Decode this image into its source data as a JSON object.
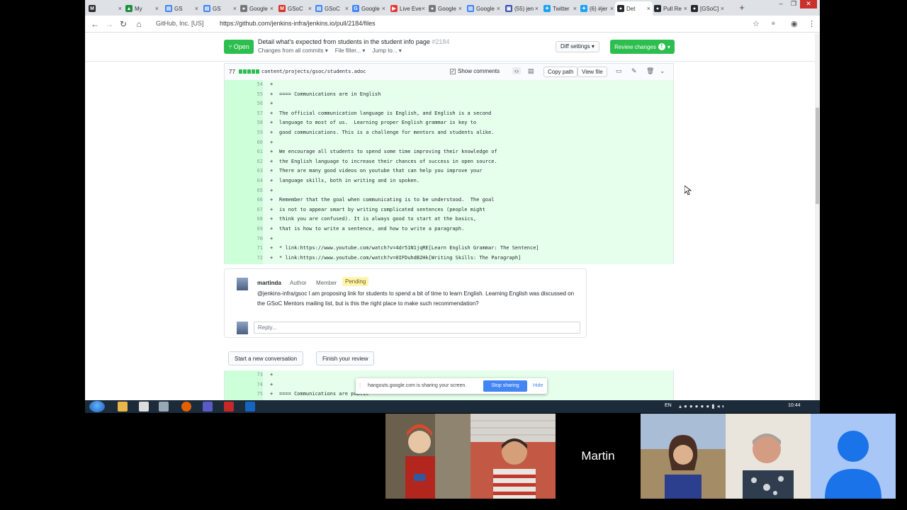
{
  "browser": {
    "tabs": [
      {
        "label": "",
        "color": "#2b2b2b",
        "glyph": "M"
      },
      {
        "label": "My",
        "color": "#1e8e3e",
        "glyph": "▲"
      },
      {
        "label": "GS",
        "color": "#4285f4",
        "glyph": "▤"
      },
      {
        "label": "GS",
        "color": "#4285f4",
        "glyph": "▤"
      },
      {
        "label": "Google",
        "color": "#777777",
        "glyph": "●"
      },
      {
        "label": "GSoC",
        "color": "#d93025",
        "glyph": "M"
      },
      {
        "label": "GSoC",
        "color": "#4285f4",
        "glyph": "▤"
      },
      {
        "label": "Google",
        "color": "#4285f4",
        "glyph": "G"
      },
      {
        "label": "Live Eve",
        "color": "#e53935",
        "glyph": "▶"
      },
      {
        "label": "Google",
        "color": "#777777",
        "glyph": "●"
      },
      {
        "label": "Google",
        "color": "#4285f4",
        "glyph": "▤"
      },
      {
        "label": "(55) jen",
        "color": "#3f51b5",
        "glyph": "▣"
      },
      {
        "label": "Twitter",
        "color": "#1da1f2",
        "glyph": "✦"
      },
      {
        "label": "(6) #jer",
        "color": "#1da1f2",
        "glyph": "✦"
      },
      {
        "label": "Det",
        "color": "#24292e",
        "glyph": "●"
      },
      {
        "label": "Pull Re",
        "color": "#24292e",
        "glyph": "●"
      },
      {
        "label": "[GSoC]",
        "color": "#24292e",
        "glyph": "●"
      }
    ],
    "new_tab": "+",
    "secure_label": "GitHub, Inc. [US]",
    "url": "https://github.com/jenkins-infra/jenkins.io/pull/2184/files"
  },
  "pr": {
    "status": "Open",
    "title": "Detail what's expected from students in the student info page",
    "number": "#2184",
    "changes_from": "Changes from all commits ▾",
    "file_filter": "File filter... ▾",
    "jump_to": "Jump to... ▾",
    "diff_settings": "Diff settings ▾",
    "review_changes": "Review changes",
    "review_badge": "!"
  },
  "file": {
    "changes": "77",
    "path": "content/projects/gsoc/students.adoc",
    "show_comments": "Show comments",
    "show_comments_checked": "✓",
    "copy_path": "Copy path",
    "view_file": "View file"
  },
  "diff_lines": [
    {
      "n": "54",
      "t": ""
    },
    {
      "n": "55",
      "t": "==== Communications are in English"
    },
    {
      "n": "56",
      "t": ""
    },
    {
      "n": "57",
      "t": "The official communication language is English, and English is a second"
    },
    {
      "n": "58",
      "t": "language to most of us.  Learning proper English grammar is key to"
    },
    {
      "n": "59",
      "t": "good communications. This is a challenge for mentors and students alike."
    },
    {
      "n": "60",
      "t": ""
    },
    {
      "n": "61",
      "t": "We encourage all students to spend some time improving their knowledge of"
    },
    {
      "n": "62",
      "t": "the English language to increase their chances of success in open source."
    },
    {
      "n": "63",
      "t": "There are many good videos on youtube that can help you improve your"
    },
    {
      "n": "64",
      "t": "language skills, both in writing and in spoken."
    },
    {
      "n": "65",
      "t": ""
    },
    {
      "n": "66",
      "t": "Remember that the goal when communicating is to be understood.  The goal"
    },
    {
      "n": "67",
      "t": "is not to appear smart by writing complicated sentences (people might"
    },
    {
      "n": "68",
      "t": "think you are confused). It is always good to start at the basics,"
    },
    {
      "n": "69",
      "t": "that is how to write a sentence, and how to write a paragraph."
    },
    {
      "n": "70",
      "t": ""
    },
    {
      "n": "71",
      "t": "* link:https://www.youtube.com/watch?v=4dr51N1jqRE[Learn English Grammar: The Sentence]"
    },
    {
      "n": "72",
      "t": "* link:https://www.youtube.com/watch?v=0IFDuhdB2Hk[Writing Skills: The Paragraph]"
    }
  ],
  "diff_lines_after": [
    {
      "n": "73",
      "t": ""
    },
    {
      "n": "74",
      "t": ""
    },
    {
      "n": "75",
      "t": "==== Communications are public"
    }
  ],
  "comment": {
    "user": "martinda",
    "role_author": "Author",
    "role_member": "Member",
    "pending": "Pending",
    "body": "@jenkins-infra/gsoc I am proposing link for students to spend a bit of time to learn English. Learning English was discussed on the GSoC Mentors mailing list, but is this the right place to make such recommendation?",
    "reply_placeholder": "Reply..."
  },
  "actions": {
    "start_conversation": "Start a new conversation",
    "finish_review": "Finish your review"
  },
  "share_bar": {
    "message": "hangouts.google.com is sharing your screen.",
    "stop": "Stop sharing",
    "hide": "Hide"
  },
  "taskbar": {
    "lang": "EN",
    "clock": "10:44"
  },
  "hangouts": {
    "center_name": "Martin"
  }
}
